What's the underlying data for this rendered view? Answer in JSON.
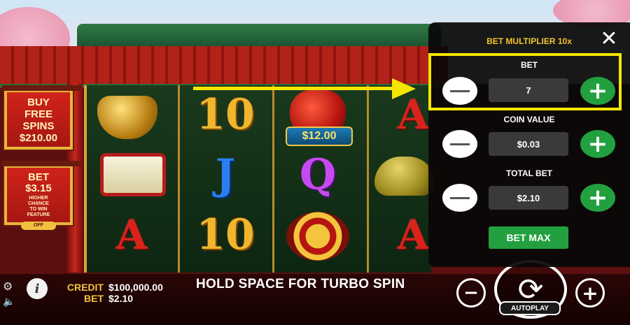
{
  "buy_free_spins": {
    "line1": "BUY",
    "line2": "FREE",
    "line3": "SPINS",
    "price": "$210.00"
  },
  "ante_bet": {
    "title": "BET",
    "amount": "$3.15",
    "desc1": "HIGHER",
    "desc2": "CHANCE",
    "desc3": "TO WIN",
    "desc4": "FEATURE",
    "toggle": "OFF"
  },
  "reels": {
    "prize_label": "$12.00",
    "symbols": [
      "pot-of-gold",
      "10",
      "money-bag",
      "A",
      "scroll",
      "J",
      "Q",
      "golden-frog",
      "A",
      "10",
      "coins",
      "A"
    ]
  },
  "bottom": {
    "credit_label": "CREDIT",
    "credit_value": "$100,000.00",
    "bet_label": "BET",
    "bet_value": "$2.10",
    "turbo_message": "HOLD SPACE FOR TURBO SPIN",
    "autoplay_label": "AUTOPLAY"
  },
  "bet_panel": {
    "title": "BET MULTIPLIER 10x",
    "bet_label": "BET",
    "bet_value": "7",
    "coin_value_label": "COIN VALUE",
    "coin_value": "$0.03",
    "total_bet_label": "TOTAL BET",
    "total_bet_value": "$2.10",
    "bet_max_label": "BET MAX"
  },
  "glyphs": {
    "close": "✕",
    "plus": "+",
    "minus": "−",
    "gear": "⚙",
    "speaker": "🔈",
    "info": "i",
    "spin": "⟳"
  },
  "colors": {
    "accent_yellow": "#f5e600",
    "gold_text": "#f4c52b",
    "plus_green": "#22a03f",
    "panel_bg": "#080808"
  }
}
